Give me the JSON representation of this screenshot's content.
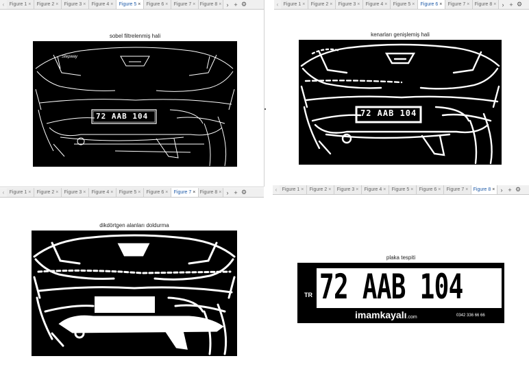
{
  "tabs": [
    "Figure 1",
    "Figure 2",
    "Figure 3",
    "Figure 4",
    "Figure 5",
    "Figure 6",
    "Figure 7",
    "Figure 8"
  ],
  "icons": {
    "left": "chevron-left-icon",
    "right": "chevron-right-icon",
    "close": "close-icon",
    "add": "plus-icon",
    "settings": "gear-icon"
  },
  "glyphs": {
    "close": "×",
    "left": "‹",
    "right": "›",
    "add": "+",
    "settings": "⚙"
  },
  "panes": [
    {
      "active_tab": "Figure 5",
      "title": "sobel filtrelenmiş hali"
    },
    {
      "active_tab": "Figure 6",
      "title": "kenarları genişlemiş hali"
    },
    {
      "active_tab": "Figure 7",
      "title": "dikdörtgen alanları doldurma"
    },
    {
      "active_tab": "Figure 8",
      "title": "plaka tespiti"
    }
  ],
  "images": {
    "plate_text": "72 AAB 104",
    "plate_country": "TR",
    "dealer_text": "imamkayalı",
    "dealer_suffix": ".com",
    "dealer_phone": "0342 336 66 66",
    "badge_text": "Stepway"
  },
  "colors": {
    "accent": "#1e5aa8",
    "tab_bg": "#ececec",
    "background": "#000000",
    "foreground": "#ffffff"
  }
}
